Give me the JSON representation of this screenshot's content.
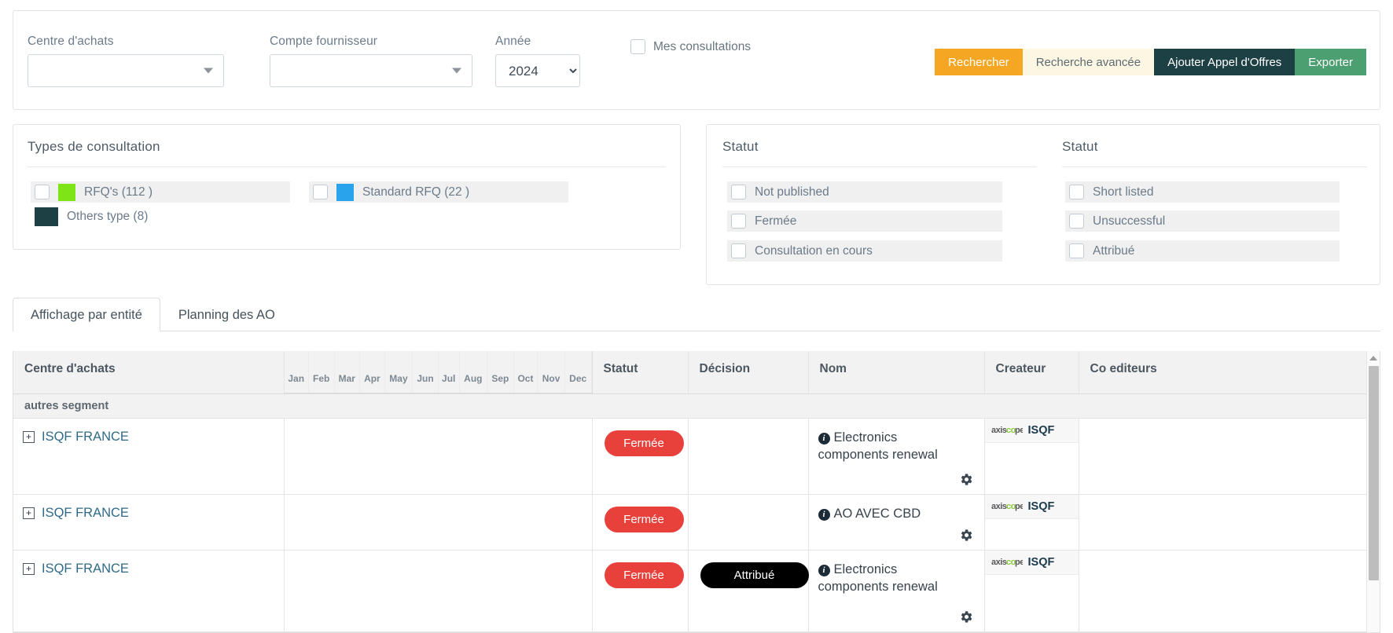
{
  "filters": {
    "centre_label": "Centre d'achats",
    "centre_value": "",
    "compte_label": "Compte fournisseur",
    "compte_value": "",
    "annee_label": "Année",
    "annee_value": "2024",
    "annee_options": [
      "2024"
    ],
    "mes_consultations_label": "Mes consultations",
    "mes_consultations_checked": false
  },
  "actions": {
    "search": "Rechercher",
    "advanced": "Recherche avancée",
    "add": "Ajouter Appel d'Offres",
    "export": "Exporter"
  },
  "colors": {
    "orange": "#f5a623",
    "cream": "#fdf6e3",
    "dark_teal": "#1d4044",
    "green": "#4c9f70",
    "bar_green": "#7ee317",
    "rfq_green": "#7ee317",
    "std_blue": "#29a3ec",
    "others_teal": "#1d4044",
    "badge_red": "#e8403a",
    "badge_black": "#000000"
  },
  "types_panel": {
    "title": "Types de consultation",
    "items": [
      {
        "label": "RFQ's (112 )",
        "color": "#7ee317",
        "checked": false,
        "has_checkbox": true
      },
      {
        "label": "Standard RFQ (22 )",
        "color": "#29a3ec",
        "checked": false,
        "has_checkbox": true
      },
      {
        "label": "Others type (8)",
        "color": "#1d4044",
        "checked": false,
        "has_checkbox": false
      }
    ]
  },
  "status_panel_left": {
    "title": "Statut",
    "items": [
      {
        "label": "Not published",
        "checked": false
      },
      {
        "label": "Fermée",
        "checked": false
      },
      {
        "label": "Consultation en cours",
        "checked": false
      }
    ]
  },
  "status_panel_right": {
    "title": "Statut",
    "items": [
      {
        "label": "Short listed",
        "checked": false
      },
      {
        "label": "Unsuccessful",
        "checked": false
      },
      {
        "label": "Attribué",
        "checked": false
      }
    ]
  },
  "tabs": [
    {
      "label": "Affichage par entité",
      "active": true
    },
    {
      "label": "Planning des AO",
      "active": false
    }
  ],
  "table": {
    "columns": {
      "centre": "Centre d'achats",
      "statut": "Statut",
      "decision": "Décision",
      "nom": "Nom",
      "createur": "Createur",
      "co_editeurs": "Co editeurs"
    },
    "months": [
      "Jan",
      "Feb",
      "Mar",
      "Apr",
      "May",
      "Jun",
      "Jul",
      "Aug",
      "Sep",
      "Oct",
      "Nov",
      "Dec"
    ],
    "segment_label": "autres segment",
    "rows": [
      {
        "centre": "ISQF FRANCE",
        "expand": "+",
        "months_filled": [
          1,
          1,
          1,
          1,
          1,
          0,
          0,
          0,
          0,
          0,
          0,
          0
        ],
        "statut": "Fermée",
        "decision": "",
        "nom": "Electronics components renewal",
        "createur": "ISQF",
        "createur_logo": "axiscope",
        "co_editeurs": ""
      },
      {
        "centre": "ISQF FRANCE",
        "expand": "+",
        "months_filled": [
          1,
          1,
          1,
          0,
          0,
          0,
          0,
          0,
          0,
          0,
          0,
          0
        ],
        "statut": "Fermée",
        "decision": "",
        "nom": "AO AVEC CBD",
        "createur": "ISQF",
        "createur_logo": "axiscope",
        "co_editeurs": ""
      },
      {
        "centre": "ISQF FRANCE",
        "expand": "+",
        "months_filled": [
          1,
          0,
          0,
          0,
          0,
          0,
          0,
          0,
          0,
          0,
          0,
          0
        ],
        "statut": "Fermée",
        "decision": "Attribué",
        "nom": "Electronics components renewal",
        "createur": "ISQF",
        "createur_logo": "axiscope",
        "co_editeurs": ""
      }
    ]
  },
  "icons": {
    "info": "i",
    "gear": "gear-icon",
    "scroll_up": "chevron-up-icon"
  }
}
